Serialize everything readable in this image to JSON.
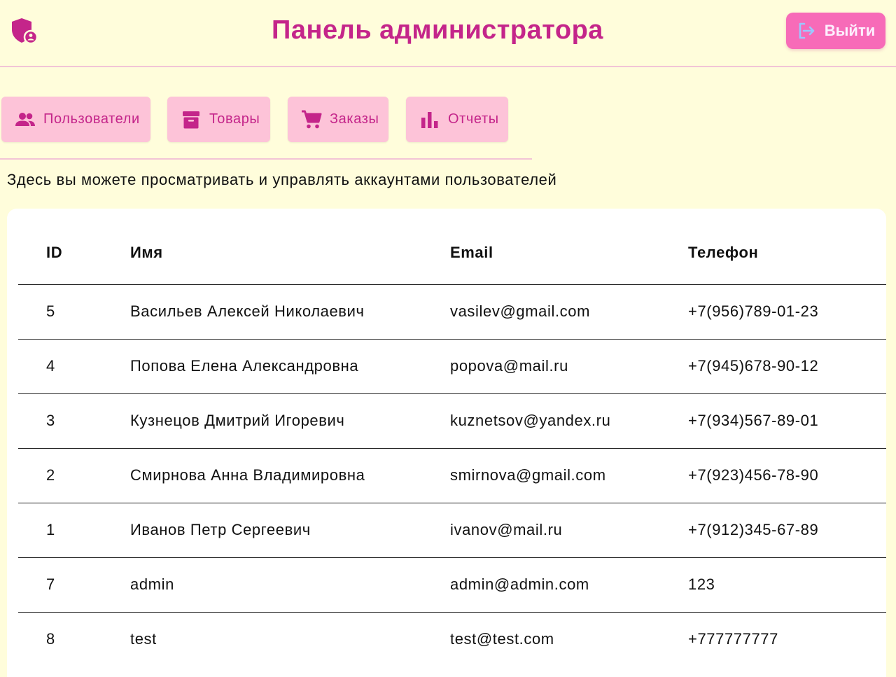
{
  "header": {
    "title": "Панель администратора",
    "logout_label": "Выйти",
    "logo_icon": "shield-user-icon",
    "logout_icon": "logout-icon"
  },
  "nav": {
    "items": [
      {
        "label": "Пользователи",
        "icon": "people-icon"
      },
      {
        "label": "Товары",
        "icon": "archive-box-icon"
      },
      {
        "label": "Заказы",
        "icon": "cart-icon"
      },
      {
        "label": "Отчеты",
        "icon": "bar-chart-icon"
      }
    ]
  },
  "description": "Здесь вы можете просматривать и управлять аккаунтами пользователей",
  "table": {
    "columns": [
      "ID",
      "Имя",
      "Email",
      "Телефон"
    ],
    "rows": [
      [
        "5",
        "Васильев Алексей Николаевич",
        "vasilev@gmail.com",
        "+7(956)789-01-23"
      ],
      [
        "4",
        "Попова Елена Александровна",
        "popova@mail.ru",
        "+7(945)678-90-12"
      ],
      [
        "3",
        "Кузнецов Дмитрий Игоревич",
        "kuznetsov@yandex.ru",
        "+7(934)567-89-01"
      ],
      [
        "2",
        "Смирнова Анна Владимировна",
        "smirnova@gmail.com",
        "+7(923)456-78-90"
      ],
      [
        "1",
        "Иванов Петр Сергеевич",
        "ivanov@mail.ru",
        "+7(912)345-67-89"
      ],
      [
        "7",
        "admin",
        "admin@admin.com",
        "123"
      ],
      [
        "8",
        "test",
        "test@test.com",
        "+777777777"
      ]
    ]
  },
  "colors": {
    "background": "#fffddb",
    "accent": "#c4258a",
    "nav_button": "#fdc3d8",
    "logout_button": "#f76bb8"
  }
}
